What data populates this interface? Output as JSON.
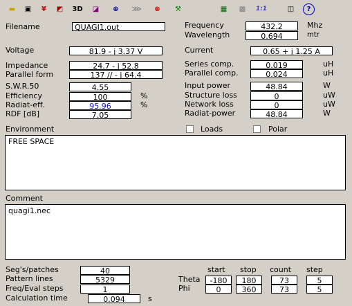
{
  "toolbar": {
    "buttons": [
      {
        "name": "open-folder-icon",
        "glyph": "▬",
        "color": "#c8a000"
      },
      {
        "name": "window-icon",
        "glyph": "▣",
        "color": "#000"
      },
      {
        "name": "antenna-icon",
        "glyph": "¥",
        "color": "#c00000"
      },
      {
        "name": "cube-icon",
        "glyph": "◩",
        "color": "#a00000"
      },
      {
        "name": "3d-button",
        "glyph": "3D",
        "color": "#000"
      },
      {
        "name": "pattern-chart-icon",
        "glyph": "◪",
        "color": "#800080"
      },
      {
        "name": "polar-plot-icon",
        "glyph": "⊕",
        "color": "#0000a0"
      },
      {
        "name": "mesh-icon",
        "glyph": "⋙",
        "color": "#808080"
      },
      {
        "name": "target-plot-icon",
        "glyph": "⊗",
        "color": "#c00000"
      },
      {
        "name": "tools-icon",
        "glyph": "⚒",
        "color": "#008000"
      },
      {
        "name": "calculator-icon",
        "glyph": "▦",
        "color": "#006000"
      },
      {
        "name": "grid-icon",
        "glyph": "▩",
        "color": "#808080"
      },
      {
        "name": "ratio-1-1-icon",
        "glyph": "1:1",
        "color": "#4040c0"
      },
      {
        "name": "book-icon",
        "glyph": "◫",
        "color": "#000"
      },
      {
        "name": "help-icon",
        "glyph": "?",
        "color": "#0000c0"
      }
    ]
  },
  "filename": {
    "label": "Filename",
    "value": "QUAGI1.out"
  },
  "frequency": {
    "label": "Frequency",
    "value": "432.2",
    "unit": "Mhz"
  },
  "wavelength": {
    "label": "Wavelength",
    "value": "0.694",
    "unit": "mtr"
  },
  "voltage": {
    "label": "Voltage",
    "value": "81.9 - j 3.37 V"
  },
  "current": {
    "label": "Current",
    "value": "0.65 + j 1.25 A"
  },
  "impedance": {
    "label": "Impedance",
    "value": "24.7 - j 52.8"
  },
  "series_comp": {
    "label": "Series comp.",
    "value": "0.019",
    "unit": "uH"
  },
  "parallel_form": {
    "label": "Parallel form",
    "value": "137 // - j 64.4"
  },
  "parallel_comp": {
    "label": "Parallel comp.",
    "value": "0.024",
    "unit": "uH"
  },
  "swr": {
    "label": "S.W.R.50",
    "value": "4.55"
  },
  "input_power": {
    "label": "Input power",
    "value": "48.84",
    "unit": "W"
  },
  "efficiency": {
    "label": "Efficiency",
    "value": "100",
    "unit": "%"
  },
  "structure_loss": {
    "label": "Structure loss",
    "value": "0",
    "unit": "uW"
  },
  "radiat_eff": {
    "label": "Radiat-eff.",
    "value": "95.96",
    "unit": "%"
  },
  "network_loss": {
    "label": "Network loss",
    "value": "0",
    "unit": "uW"
  },
  "rdf": {
    "label": "RDF [dB]",
    "value": "7.05"
  },
  "radiat_power": {
    "label": "Radiat-power",
    "value": "48.84",
    "unit": "W"
  },
  "environment": {
    "label": "Environment",
    "text": "FREE SPACE"
  },
  "loads": {
    "label": "Loads",
    "checked": false
  },
  "polar": {
    "label": "Polar",
    "checked": false
  },
  "comment": {
    "label": "Comment",
    "text": "quagi1.nec"
  },
  "segs": {
    "label": "Seg's/patches",
    "value": "40"
  },
  "pattern_lines": {
    "label": "Pattern lines",
    "value": "5329"
  },
  "freq_eval": {
    "label": "Freq/Eval steps",
    "value": "1"
  },
  "calc_time": {
    "label": "Calculation time",
    "value": "0.094",
    "unit": "s"
  },
  "sweep": {
    "headers": {
      "start": "start",
      "stop": "stop",
      "count": "count",
      "step": "step"
    },
    "theta": {
      "label": "Theta",
      "start": "-180",
      "stop": "180",
      "count": "73",
      "step": "5"
    },
    "phi": {
      "label": "Phi",
      "start": "0",
      "stop": "360",
      "count": "73",
      "step": "5"
    }
  }
}
